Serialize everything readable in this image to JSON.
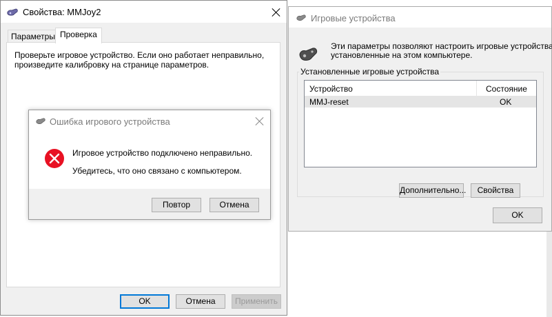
{
  "bg_window": {
    "title": "Свойства: MMJoy2",
    "tabs": [
      {
        "label": "Параметры",
        "active": false
      },
      {
        "label": "Проверка",
        "active": true
      }
    ],
    "check_text_line1": "Проверьте игровое устройство. Если оно работает неправильно,",
    "check_text_line2": "произведите калибровку на странице параметров.",
    "buttons": {
      "ok": "OK",
      "cancel": "Отмена",
      "apply": "Применить"
    }
  },
  "game_controllers": {
    "title": "Игровые устройства",
    "description_line1": "Эти параметры позволяют настроить игровые устройства,",
    "description_line2": "установленные на этом компьютере.",
    "group_label": "Установленные игровые устройства",
    "columns": [
      "Устройство",
      "Состояние"
    ],
    "rows": [
      {
        "device": "MMJ-reset",
        "status": "OK"
      }
    ],
    "buttons": {
      "advanced": "Дополнительно...",
      "properties": "Свойства",
      "ok": "OK"
    }
  },
  "error_dialog": {
    "title": "Ошибка игрового устройства",
    "message_line1": "Игровое устройство подключено неправильно.",
    "message_line2": "Убедитесь, что оно связано с компьютером.",
    "buttons": {
      "retry": "Повтор",
      "cancel": "Отмена"
    }
  },
  "colors": {
    "accent": "#0078d7",
    "error_icon": "#e81123",
    "window_bg": "#f0f0f0",
    "selected_row": "#e5e5e5"
  },
  "icons": [
    "gamepad-icon",
    "error-icon",
    "close-icon"
  ]
}
